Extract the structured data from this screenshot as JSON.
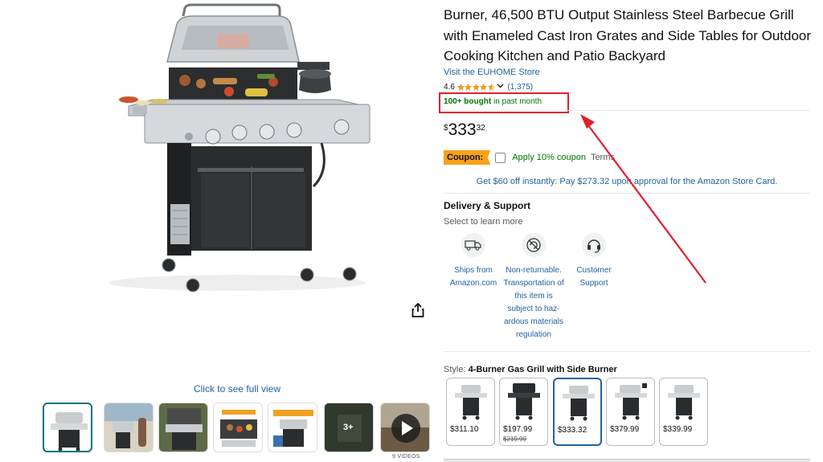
{
  "product": {
    "title": "Burner, 46,500 BTU Output Stainless Steel Barbecue Grill with Enameled Cast Iron Grates and Side Tables for Outdoor Cooking Kitchen and Patio Backyard",
    "store_link": "Visit the EUHOME Store",
    "rating": "4.6",
    "rating_count": "(1,375)",
    "bought_bold": "100+ bought",
    "bought_rest": " in past month",
    "price_symbol": "$",
    "price_whole": "333",
    "price_fraction": "32"
  },
  "coupon": {
    "badge": "Coupon:",
    "text": "Apply 10% coupon",
    "terms": "Terms"
  },
  "card_offer": "Get $60 off instantly: Pay $273.32 upon approval for the Amazon Store Card.",
  "delivery": {
    "title": "Delivery & Support",
    "subtitle": "Select to learn more",
    "items": [
      {
        "label": "Ships from Amazon.com",
        "icon": "truck-icon"
      },
      {
        "label": "Non-returnable. Transportation of this item is subject to haz-ardous materials regulation",
        "icon": "no-return-icon"
      },
      {
        "label": "Customer Support",
        "icon": "headset-icon"
      }
    ]
  },
  "style": {
    "label": "Style: ",
    "selected": "4-Burner Gas Grill with Side Burner",
    "options": [
      {
        "price": "$311.10",
        "old_price": ""
      },
      {
        "price": "$197.99",
        "old_price": "$219.99"
      },
      {
        "price": "$333.32",
        "old_price": ""
      },
      {
        "price": "$379.99",
        "old_price": ""
      },
      {
        "price": "$339.99",
        "old_price": ""
      }
    ]
  },
  "gallery": {
    "see_full": "Click to see full view",
    "thumb_more": "3+",
    "videos_label": "9 VIDEOS"
  },
  "colors": {
    "link": "#2162a1",
    "green": "#007600",
    "coupon_orange": "#f8a11a",
    "annotation_red": "#e0202a"
  }
}
